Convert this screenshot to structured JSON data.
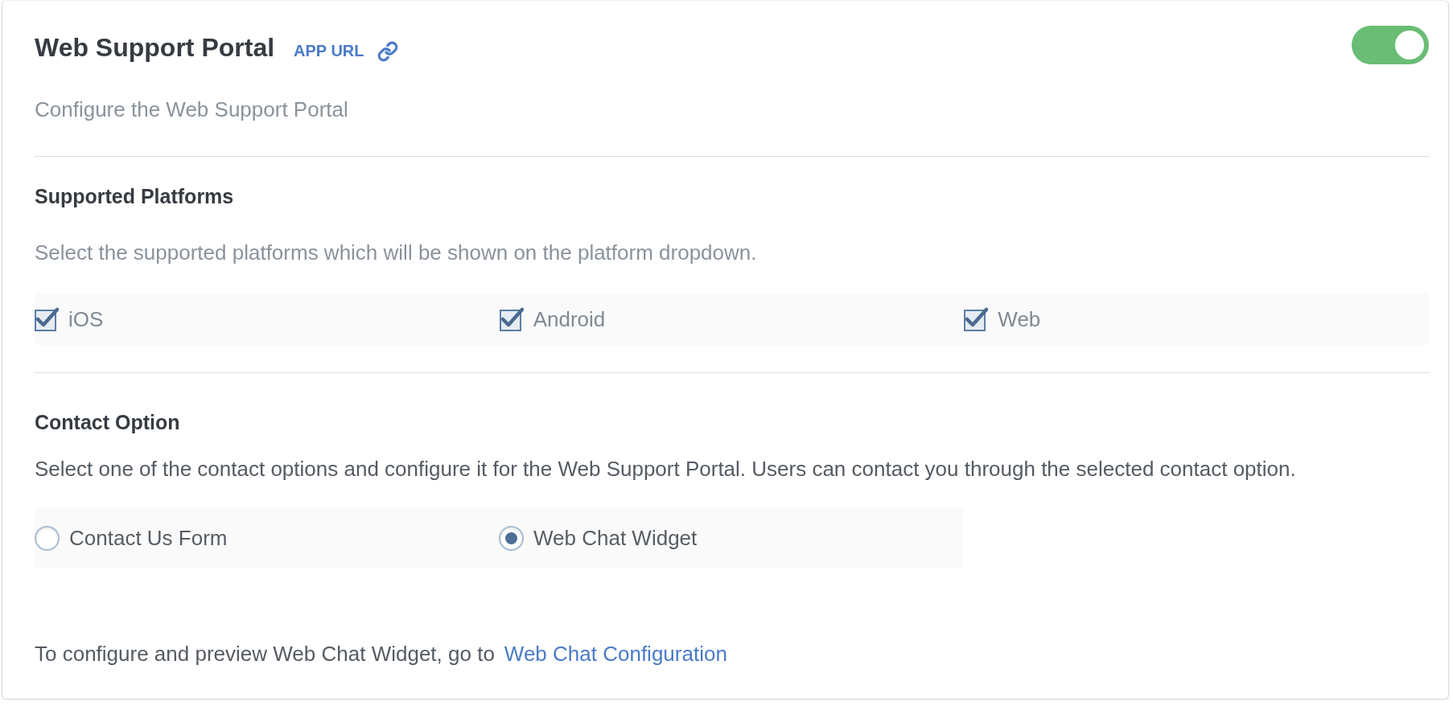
{
  "header": {
    "title": "Web Support Portal",
    "app_url_link": "APP URL",
    "enabled": true,
    "description": "Configure the Web Support Portal"
  },
  "platforms": {
    "heading": "Supported Platforms",
    "description": "Select the supported platforms which will be shown on the platform dropdown.",
    "options": [
      {
        "label": "iOS",
        "checked": true
      },
      {
        "label": "Android",
        "checked": true
      },
      {
        "label": "Web",
        "checked": true
      }
    ]
  },
  "contact": {
    "heading": "Contact Option",
    "description": "Select one of the contact options and configure it for the Web Support Portal. Users can contact you through the selected contact option.",
    "options": [
      {
        "label": "Contact Us Form",
        "selected": false
      },
      {
        "label": "Web Chat Widget",
        "selected": true
      }
    ]
  },
  "footer_note": {
    "text": "To configure and preview Web Chat Widget, go to",
    "link": "Web Chat Configuration"
  }
}
